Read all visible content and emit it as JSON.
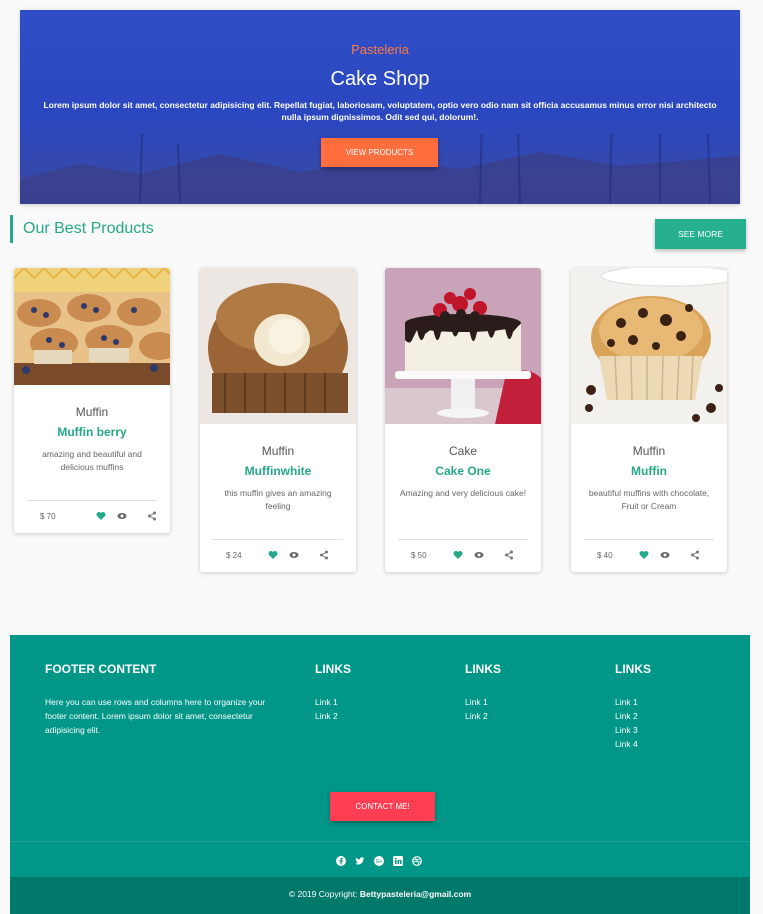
{
  "hero": {
    "subtitle": "Pasteleria",
    "title": "Cake Shop",
    "text": "Lorem ipsum dolor sit amet, consectetur adipisicing elit. Repellat fugiat, laboriosam, voluptatem, optio vero odio nam sit officia accusamus minus error nisi architecto nulla ipsum dignissimos. Odit sed qui, dolorum!.",
    "button": "VIEW PRODUCTS"
  },
  "section": {
    "title": "Our Best Products",
    "see_more": "SEE MORE"
  },
  "products": [
    {
      "category": "Muffin",
      "name": "Muffin berry",
      "desc": "amazing and beautiful and delicious muffins",
      "price": "$ 70"
    },
    {
      "category": "Muffin",
      "name": "Muffinwhite",
      "desc": "this muffin gives an amazing feeling",
      "price": "$ 24"
    },
    {
      "category": "Cake",
      "name": "Cake One",
      "desc": "Amazing and very delicious cake!",
      "price": "$ 50"
    },
    {
      "category": "Muffin",
      "name": "Muffin",
      "desc": "beautiful muffins with chocolate, Fruit or Cream",
      "price": "$ 40"
    }
  ],
  "footer": {
    "heading": "FOOTER CONTENT",
    "text": "Here you can use rows and columns here to organize your footer content. Lorem ipsum dolor sit amet, consectetur adipisicing elit.",
    "links_heading": "LINKS",
    "links_col1": [
      "Link 1",
      "Link 2"
    ],
    "links_col2": [
      "Link 1",
      "Link 2"
    ],
    "links_col3": [
      "Link 1",
      "Link 2",
      "Link 3",
      "Link 4"
    ],
    "contact_button": "CONTACT ME!",
    "copyright_prefix": "© 2019 Copyright: ",
    "copyright_email": "Bettypasteleria@gmail.com"
  },
  "colors": {
    "accent": "#26a889",
    "hero_button": "#ff6e3c",
    "footer": "#009688",
    "contact": "#ff3d53"
  },
  "icons": [
    "heart-icon",
    "eye-icon",
    "share-icon",
    "facebook-icon",
    "twitter-icon",
    "google-plus-icon",
    "linkedin-icon",
    "dribbble-icon"
  ]
}
